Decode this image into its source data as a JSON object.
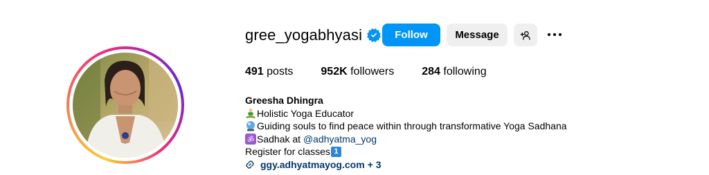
{
  "profile": {
    "username": "gree_yogabhyasi",
    "verified": true,
    "accent_color": "#0095f6"
  },
  "actions": {
    "follow_label": "Follow",
    "message_label": "Message"
  },
  "stats": {
    "posts_count": "491",
    "posts_label": "posts",
    "followers_count": "952K",
    "followers_label": "followers",
    "following_count": "284",
    "following_label": "following"
  },
  "bio": {
    "full_name": "Greesha Dhingra",
    "line1": "Holistic Yoga Educator",
    "line2": "Guiding souls to find peace within through transformative Yoga Sadhana",
    "line3_prefix": "Sadhak at ",
    "line3_mention": "@adhyatma_yog",
    "line4": "Register for classes",
    "line4_keycap": "1",
    "link_text": "ggy.adhyatmayog.com",
    "link_more": "+ 3"
  },
  "icons": {
    "verified": "verified-badge-icon",
    "suggest": "add-person-icon",
    "more": "more-options-icon",
    "link": "link-icon",
    "meditation": "person-in-lotus-position-emoji",
    "crystal": "crystal-ball-emoji",
    "om": "om-symbol-emoji",
    "keycap": "keycap-one-emoji"
  }
}
